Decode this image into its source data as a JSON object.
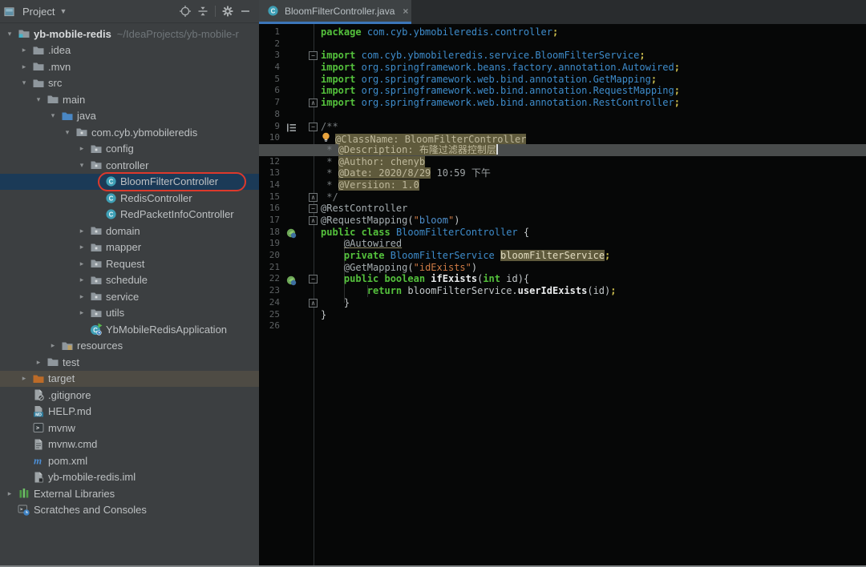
{
  "project_panel": {
    "header": {
      "title": "Project",
      "icons": [
        "tool-window-icon",
        "chevron-down-icon",
        "locate-file-icon",
        "collapse-all-icon",
        "settings-gear-icon",
        "hide-panel-icon"
      ]
    },
    "tree": [
      {
        "label": "yb-mobile-redis",
        "sublabel": "~/IdeaProjects/yb-mobile-r",
        "level": 0,
        "arrow": "expanded",
        "icon": "project-root",
        "bold": true
      },
      {
        "label": ".idea",
        "level": 1,
        "arrow": "collapsed",
        "icon": "folder"
      },
      {
        "label": ".mvn",
        "level": 1,
        "arrow": "collapsed",
        "icon": "folder"
      },
      {
        "label": "src",
        "level": 1,
        "arrow": "expanded",
        "icon": "folder"
      },
      {
        "label": "main",
        "level": 2,
        "arrow": "expanded",
        "icon": "folder"
      },
      {
        "label": "java",
        "level": 3,
        "arrow": "expanded",
        "icon": "folder-source"
      },
      {
        "label": "com.cyb.ybmobileredis",
        "level": 4,
        "arrow": "expanded",
        "icon": "folder-package"
      },
      {
        "label": "config",
        "level": 5,
        "arrow": "collapsed",
        "icon": "folder-package"
      },
      {
        "label": "controller",
        "level": 5,
        "arrow": "expanded",
        "icon": "folder-package"
      },
      {
        "label": "BloomFilterController",
        "level": 6,
        "arrow": "none",
        "icon": "class",
        "state": "selected"
      },
      {
        "label": "RedisController",
        "level": 6,
        "arrow": "none",
        "icon": "class"
      },
      {
        "label": "RedPacketInfoController",
        "level": 6,
        "arrow": "none",
        "icon": "class"
      },
      {
        "label": "domain",
        "level": 5,
        "arrow": "collapsed",
        "icon": "folder-package"
      },
      {
        "label": "mapper",
        "level": 5,
        "arrow": "collapsed",
        "icon": "folder-package"
      },
      {
        "label": "Request",
        "level": 5,
        "arrow": "collapsed",
        "icon": "folder-package"
      },
      {
        "label": "schedule",
        "level": 5,
        "arrow": "collapsed",
        "icon": "folder-package"
      },
      {
        "label": "service",
        "level": 5,
        "arrow": "collapsed",
        "icon": "folder-package"
      },
      {
        "label": "utils",
        "level": 5,
        "arrow": "collapsed",
        "icon": "folder-package"
      },
      {
        "label": "YbMobileRedisApplication",
        "level": 5,
        "arrow": "none",
        "icon": "class-run"
      },
      {
        "label": "resources",
        "level": 3,
        "arrow": "collapsed",
        "icon": "folder-resources"
      },
      {
        "label": "test",
        "level": 2,
        "arrow": "collapsed",
        "icon": "folder"
      },
      {
        "label": "target",
        "level": 1,
        "arrow": "collapsed",
        "icon": "folder-excluded",
        "state": "highlighted"
      },
      {
        "label": ".gitignore",
        "level": 1,
        "arrow": "none",
        "icon": "file-ignored"
      },
      {
        "label": "HELP.md",
        "level": 1,
        "arrow": "none",
        "icon": "file-markdown"
      },
      {
        "label": "mvnw",
        "level": 1,
        "arrow": "none",
        "icon": "file-console"
      },
      {
        "label": "mvnw.cmd",
        "level": 1,
        "arrow": "none",
        "icon": "file-text"
      },
      {
        "label": "pom.xml",
        "level": 1,
        "arrow": "none",
        "icon": "maven"
      },
      {
        "label": "yb-mobile-redis.iml",
        "level": 1,
        "arrow": "none",
        "icon": "file-iml"
      },
      {
        "label": "External Libraries",
        "level": 0,
        "arrow": "collapsed",
        "icon": "libraries"
      },
      {
        "label": "Scratches and Consoles",
        "level": 0,
        "arrow": "none",
        "icon": "scratches"
      }
    ]
  },
  "editor": {
    "tab": {
      "title": "BloomFilterController.java",
      "icon": "class",
      "close_label": "×"
    },
    "lines": [
      {
        "n": "1",
        "tokens": [
          [
            "kw",
            "package"
          ],
          [
            "pl",
            " "
          ],
          [
            "ref",
            "com.cyb.ybmobileredis.controller"
          ],
          [
            "semi",
            ";"
          ]
        ]
      },
      {
        "n": "2",
        "tokens": []
      },
      {
        "n": "3",
        "fold": "m",
        "tokens": [
          [
            "kw",
            "import"
          ],
          [
            "pl",
            " "
          ],
          [
            "ref",
            "com.cyb.ybmobileredis.service.BloomFilterService"
          ],
          [
            "semi",
            ";"
          ]
        ]
      },
      {
        "n": "4",
        "tokens": [
          [
            "kw",
            "import"
          ],
          [
            "pl",
            " "
          ],
          [
            "ref",
            "org.springframework.beans.factory.annotation.Autowired"
          ],
          [
            "semi",
            ";"
          ]
        ]
      },
      {
        "n": "5",
        "tokens": [
          [
            "kw",
            "import"
          ],
          [
            "pl",
            " "
          ],
          [
            "ref",
            "org.springframework.web.bind.annotation.GetMapping"
          ],
          [
            "semi",
            ";"
          ]
        ]
      },
      {
        "n": "6",
        "tokens": [
          [
            "kw",
            "import"
          ],
          [
            "pl",
            " "
          ],
          [
            "ref",
            "org.springframework.web.bind.annotation.RequestMapping"
          ],
          [
            "semi",
            ";"
          ]
        ]
      },
      {
        "n": "7",
        "fold": "e",
        "tokens": [
          [
            "kw",
            "import"
          ],
          [
            "pl",
            " "
          ],
          [
            "ref",
            "org.springframework.web.bind.annotation.RestController"
          ],
          [
            "semi",
            ";"
          ]
        ]
      },
      {
        "n": "8",
        "tokens": []
      },
      {
        "n": "9",
        "fold": "m",
        "gicon": "structure",
        "tokens": [
          [
            "cmt",
            "/**"
          ]
        ]
      },
      {
        "n": "10",
        "tokens": [
          [
            "bulb",
            ""
          ],
          [
            "sel",
            "@ClassName: BloomFilterController"
          ]
        ]
      },
      {
        "n": "11",
        "caret_line": true,
        "hide_number": true,
        "tokens": [
          [
            "cmt",
            " * "
          ],
          [
            "sel",
            "@Description: 布隆过滤器控制层"
          ],
          [
            "caret",
            ""
          ]
        ]
      },
      {
        "n": "12",
        "tokens": [
          [
            "cmt",
            " * "
          ],
          [
            "sel",
            "@Author: chenyb"
          ]
        ]
      },
      {
        "n": "13",
        "tokens": [
          [
            "cmt",
            " * "
          ],
          [
            "sel",
            "@Date: 2020/8/29"
          ],
          [
            "cmt2",
            " 10:59 下午"
          ]
        ]
      },
      {
        "n": "14",
        "tokens": [
          [
            "cmt",
            " * "
          ],
          [
            "sel",
            "@Versiion: 1.0"
          ]
        ]
      },
      {
        "n": "15",
        "fold": "e",
        "tokens": [
          [
            "cmt",
            " */"
          ]
        ]
      },
      {
        "n": "16",
        "fold": "m",
        "tokens": [
          [
            "ann",
            "@RestController"
          ]
        ]
      },
      {
        "n": "17",
        "fold": "e",
        "tokens": [
          [
            "ann",
            "@RequestMapping"
          ],
          [
            "pl",
            "("
          ],
          [
            "str",
            "\""
          ],
          [
            "strv",
            "bloom"
          ],
          [
            "str",
            "\""
          ],
          [
            "pl",
            ")"
          ]
        ]
      },
      {
        "n": "18",
        "gicon": "spring",
        "tokens": [
          [
            "kw",
            "public class"
          ],
          [
            "pl",
            " "
          ],
          [
            "ref",
            "BloomFilterController"
          ],
          [
            "pl",
            " {"
          ]
        ]
      },
      {
        "n": "19",
        "tokens": [
          [
            "pl",
            "    "
          ],
          [
            "annu",
            "@Autowired"
          ]
        ]
      },
      {
        "n": "20",
        "tokens": [
          [
            "pl",
            "    "
          ],
          [
            "kw",
            "private"
          ],
          [
            "pl",
            " "
          ],
          [
            "ref",
            "BloomFilterService"
          ],
          [
            "pl",
            " "
          ],
          [
            "hl",
            "bloomFilterService"
          ],
          [
            "semi",
            ";"
          ]
        ]
      },
      {
        "n": "21",
        "tokens": [
          [
            "pl",
            "    "
          ],
          [
            "ann",
            "@GetMapping"
          ],
          [
            "pl",
            "("
          ],
          [
            "str",
            "\"idExists\""
          ],
          [
            "pl",
            ")"
          ]
        ]
      },
      {
        "n": "22",
        "fold": "m",
        "gicon": "spring",
        "tokens": [
          [
            "pl",
            "    "
          ],
          [
            "kw",
            "public boolean"
          ],
          [
            "pl",
            " "
          ],
          [
            "mth",
            "ifExists"
          ],
          [
            "pl",
            "("
          ],
          [
            "kw",
            "int"
          ],
          [
            "pl",
            " id){"
          ]
        ]
      },
      {
        "n": "23",
        "tokens": [
          [
            "pl",
            "        "
          ],
          [
            "kw",
            "return"
          ],
          [
            "pl",
            " bloomFilterService."
          ],
          [
            "mth",
            "userIdExists"
          ],
          [
            "pl",
            "(id)"
          ],
          [
            "semi",
            ";"
          ]
        ]
      },
      {
        "n": "24",
        "fold": "e",
        "tokens": [
          [
            "pl",
            "    }"
          ]
        ]
      },
      {
        "n": "25",
        "tokens": [
          [
            "pl",
            "}"
          ]
        ]
      },
      {
        "n": "26",
        "tokens": []
      }
    ]
  },
  "colors": {
    "panel_bg": "#3C3F41",
    "editor_bg": "#060707",
    "selection_row": "#1B3A57",
    "caret_line": "#494C4C",
    "identifier_highlight": "#5F5A3C",
    "keyword": "#54C13C",
    "reference": "#3E8CCB",
    "annotation_ring": "#DD392C",
    "tab_underline": "#3C76B9"
  }
}
